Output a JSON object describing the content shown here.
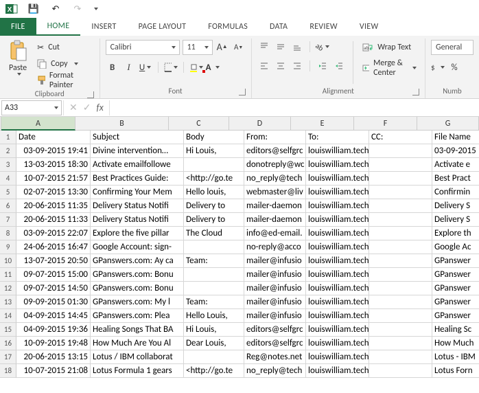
{
  "qat": {
    "save": "💾",
    "undo": "↶",
    "redo": "↷"
  },
  "tabs": {
    "file": "FILE",
    "home": "HOME",
    "insert": "INSERT",
    "page": "PAGE LAYOUT",
    "formulas": "FORMULAS",
    "data": "DATA",
    "review": "REVIEW",
    "view": "VIEW"
  },
  "ribbon": {
    "paste": "Paste",
    "cut": "Cut",
    "copy": "Copy",
    "fp": "Format Painter",
    "group_clipboard": "Clipboard",
    "font_name": "Calibri",
    "font_size": "11",
    "bold": "B",
    "italic": "I",
    "underline": "U",
    "group_font": "Font",
    "wrap": "Wrap Text",
    "merge": "Merge & Center",
    "group_align": "Alignment",
    "number_format": "General",
    "group_number": "Numb"
  },
  "fx": {
    "namebox": "A33",
    "cancel": "✕",
    "enter": "✓",
    "fx": "fx"
  },
  "columns": [
    "A",
    "B",
    "C",
    "D",
    "E",
    "F",
    "G"
  ],
  "headers": {
    "A": "Date",
    "B": "Subject",
    "C": "Body",
    "D": "From:",
    "E": "To:",
    "F": "CC:",
    "G": "File Name"
  },
  "rows": [
    {
      "n": 1
    },
    {
      "n": 2,
      "A": "03-09-2015 19:41",
      "B": "Divine intervention…",
      "C": "Hi Louis,",
      "D": "editors@selfgrc",
      "E": "louiswilliam.techie@gmail.c",
      "G": "03-09-2015"
    },
    {
      "n": 3,
      "A": "13-03-2015 18:30",
      "B": "Activate emailfollowe",
      "D": "donotreply@wc",
      "E": "louiswilliam.techie@gmail.c",
      "G": "Activate e"
    },
    {
      "n": 4,
      "A": "10-07-2015 21:57",
      "B": "Best Practices Guide:",
      "C": "<http://go.te",
      "D": "no_reply@tech",
      "E": "louiswilliam.techie@gmail.c",
      "G": "Best Pract"
    },
    {
      "n": 5,
      "A": "02-07-2015 13:30",
      "B": "Confirming Your Mem",
      "C": "Hello louis,",
      "D": "webmaster@liv",
      "E": "louiswilliam.techie@gmail.c",
      "G": "Confirmin"
    },
    {
      "n": 6,
      "A": "20-06-2015 11:35",
      "B": "Delivery Status Notifi",
      "C": "Delivery to",
      "D": "mailer-daemon",
      "E": "louiswilliam.techie@gmail.c",
      "G": "Delivery S"
    },
    {
      "n": 7,
      "A": "20-06-2015 11:33",
      "B": "Delivery Status Notifi",
      "C": "Delivery to",
      "D": "mailer-daemon",
      "E": "louiswilliam.techie@gmail.c",
      "G": "Delivery S"
    },
    {
      "n": 8,
      "A": "03-09-2015 22:07",
      "B": "Explore the five pillar",
      "C": "The Cloud",
      "D": "info@ed-email.",
      "E": "louiswilliam.techie@gmail.c",
      "G": "Explore th"
    },
    {
      "n": 9,
      "A": "24-06-2015 16:47",
      "B": "Google Account: sign-",
      "D": "no-reply@acco",
      "E": "louiswilliam.techie@gmail.c",
      "G": "Google Ac"
    },
    {
      "n": 10,
      "A": "13-07-2015 20:50",
      "B": "GPanswers.com: Ay ca",
      "C": "Team:",
      "D": "mailer@infusio",
      "E": "louiswilliam.techie@gmail.c",
      "G": "GPanswer"
    },
    {
      "n": 11,
      "A": "09-07-2015 15:00",
      "B": "GPanswers.com: Bonu",
      "D": "mailer@infusio",
      "E": "louiswilliam.techie@gmail.c",
      "G": "GPanswer"
    },
    {
      "n": 12,
      "A": "09-07-2015 14:50",
      "B": "GPanswers.com: Bonu",
      "D": "mailer@infusio",
      "E": "louiswilliam.techie@gmail.c",
      "G": "GPanswer"
    },
    {
      "n": 13,
      "A": "09-09-2015 01:30",
      "B": "GPanswers.com: My l",
      "C": "Team:",
      "D": "mailer@infusio",
      "E": "louiswilliam.techie@gmail.c",
      "G": "GPanswer"
    },
    {
      "n": 14,
      "A": "04-09-2015 14:45",
      "B": "GPanswers.com: Plea",
      "C": "Hello Louis,",
      "D": "mailer@infusio",
      "E": "louiswilliam.techie@gmail.c",
      "G": "GPanswer"
    },
    {
      "n": 15,
      "A": "04-09-2015 19:36",
      "B": "Healing Songs That BA",
      "C": "Hi Louis,",
      "D": "editors@selfgrc",
      "E": "louiswilliam.techie@gmail.c",
      "G": "Healing Sc"
    },
    {
      "n": 16,
      "A": "10-09-2015 19:48",
      "B": "How Much Are You Al",
      "C": "Dear Louis,",
      "D": "editors@selfgrc",
      "E": "louiswilliam.techie@gmail.c",
      "G": "How Much"
    },
    {
      "n": 17,
      "A": "20-06-2015 13:15",
      "B": "Lotus / IBM collaborat",
      "D": "Reg@notes.net",
      "E": "louiswilliam.techie@gmail.c",
      "G": "Lotus - IBM"
    },
    {
      "n": 18,
      "A": "10-07-2015 21:08",
      "B": "Lotus Formula 1 gears",
      "C": "<http://go.te",
      "D": "no_reply@tech",
      "E": "louiswilliam.techie@gmail.c",
      "G": "Lotus Forn"
    }
  ]
}
